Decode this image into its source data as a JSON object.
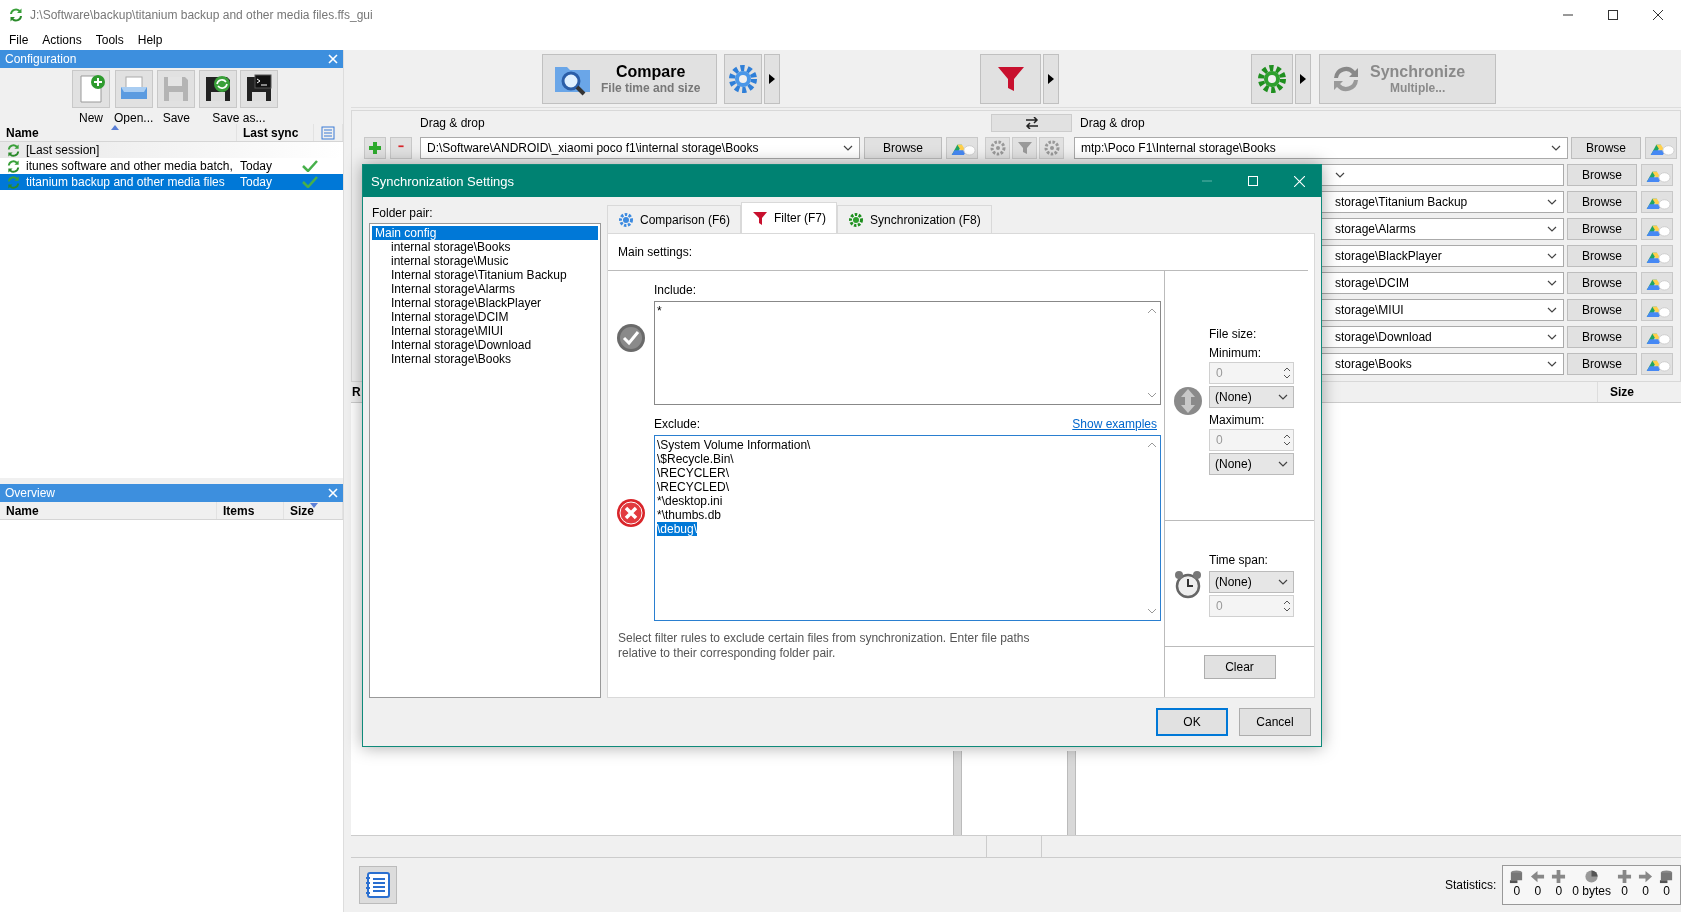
{
  "window": {
    "title": "J:\\Software\\backup\\titanium backup and other media files.ffs_gui"
  },
  "menu": [
    "File",
    "Actions",
    "Tools",
    "Help"
  ],
  "config_panel": {
    "title": "Configuration",
    "tools": [
      {
        "label": "New",
        "disabled": false
      },
      {
        "label": "Open...",
        "disabled": false
      },
      {
        "label": "Save",
        "disabled": true
      },
      {
        "label": "Save as...",
        "disabled": false
      }
    ],
    "columns": [
      "Name",
      "Last sync"
    ],
    "rows": [
      {
        "name": "[Last session]",
        "synced": false,
        "selected": false
      },
      {
        "name": "itunes software and other media batch,",
        "last_sync": "Today",
        "synced": true,
        "selected": false
      },
      {
        "name": "titanium backup and other media files",
        "last_sync": "Today",
        "synced": true,
        "selected": true
      }
    ]
  },
  "overview_panel": {
    "title": "Overview",
    "columns": [
      "Name",
      "Items",
      "Size"
    ]
  },
  "toolbar": {
    "compare": {
      "label": "Compare",
      "sublabel": "File time and size"
    },
    "synchronize": {
      "label": "Synchronize",
      "sublabel": "Multiple...",
      "disabled": true
    }
  },
  "folder_pairs": {
    "left_header": "Drag & drop",
    "right_header": "Drag & drop",
    "first": {
      "left": "D:\\Software\\ANDROID\\_xiaomi poco f1\\internal storage\\Books",
      "left_browse": "Browse",
      "right": "mtp:\\Poco F1\\Internal storage\\Books",
      "right_browse": "Browse"
    },
    "rows": [
      {
        "browse": "Browse"
      },
      {
        "right": "storage\\Titanium Backup",
        "browse": "Browse"
      },
      {
        "right": "storage\\Alarms",
        "browse": "Browse"
      },
      {
        "right": "storage\\BlackPlayer",
        "browse": "Browse"
      },
      {
        "right": "storage\\DCIM",
        "browse": "Browse"
      },
      {
        "right": "storage\\MIUI",
        "browse": "Browse"
      },
      {
        "right": "storage\\Download",
        "browse": "Browse"
      },
      {
        "right": "storage\\Books",
        "browse": "Browse"
      }
    ]
  },
  "file_list": {
    "left_columns": [
      "R"
    ],
    "right_columns": [
      "Size"
    ]
  },
  "statistics": {
    "label": "Statistics:",
    "values": [
      "0",
      "0",
      "0",
      "0 bytes",
      "0",
      "0",
      "0"
    ]
  },
  "dialog": {
    "title": "Synchronization Settings",
    "folder_pair_label": "Folder pair:",
    "pairs": [
      {
        "label": "Main config",
        "selected": true,
        "children": [
          {
            "label": "internal storage\\Books",
            "selected": false
          },
          {
            "label": "internal storage\\Music",
            "selected": false
          },
          {
            "label": "Internal storage\\Titanium Backup",
            "selected": false
          },
          {
            "label": "Internal storage\\Alarms",
            "selected": false
          },
          {
            "label": "Internal storage\\BlackPlayer",
            "selected": false
          },
          {
            "label": "Internal storage\\DCIM",
            "selected": false
          },
          {
            "label": "Internal storage\\MIUI",
            "selected": false
          },
          {
            "label": "Internal storage\\Download",
            "selected": false
          },
          {
            "label": "Internal storage\\Books",
            "selected": false
          }
        ]
      }
    ],
    "tabs": [
      {
        "label": "Comparison (F6)",
        "selected": false
      },
      {
        "label": "Filter (F7)",
        "selected": true
      },
      {
        "label": "Synchronization (F8)",
        "selected": false
      }
    ],
    "main_settings": "Main settings:",
    "include": {
      "label": "Include:",
      "lines": [
        {
          "text": "*",
          "selected": false
        }
      ]
    },
    "exclude": {
      "label": "Exclude:",
      "link": "Show examples",
      "lines": [
        {
          "text": "\\System Volume Information\\",
          "selected": false
        },
        {
          "text": "\\$Recycle.Bin\\",
          "selected": false
        },
        {
          "text": "\\RECYCLER\\",
          "selected": false
        },
        {
          "text": "\\RECYCLED\\",
          "selected": false
        },
        {
          "text": "*\\desktop.ini",
          "selected": false
        },
        {
          "text": "*\\thumbs.db",
          "selected": false
        },
        {
          "text": "\\debug\\",
          "selected": true
        }
      ]
    },
    "hint": "Select filter rules to exclude certain files from synchronization. Enter file paths relative to their corresponding folder pair.",
    "file_size": {
      "label": "File size:",
      "minimum": {
        "label": "Minimum:",
        "value": "0",
        "unit": "(None)"
      },
      "maximum": {
        "label": "Maximum:",
        "value": "0",
        "unit": "(None)"
      }
    },
    "time_span": {
      "label": "Time span:",
      "unit": "(None)",
      "value": "0"
    },
    "clear": "Clear",
    "ok": "OK",
    "cancel": "Cancel"
  }
}
